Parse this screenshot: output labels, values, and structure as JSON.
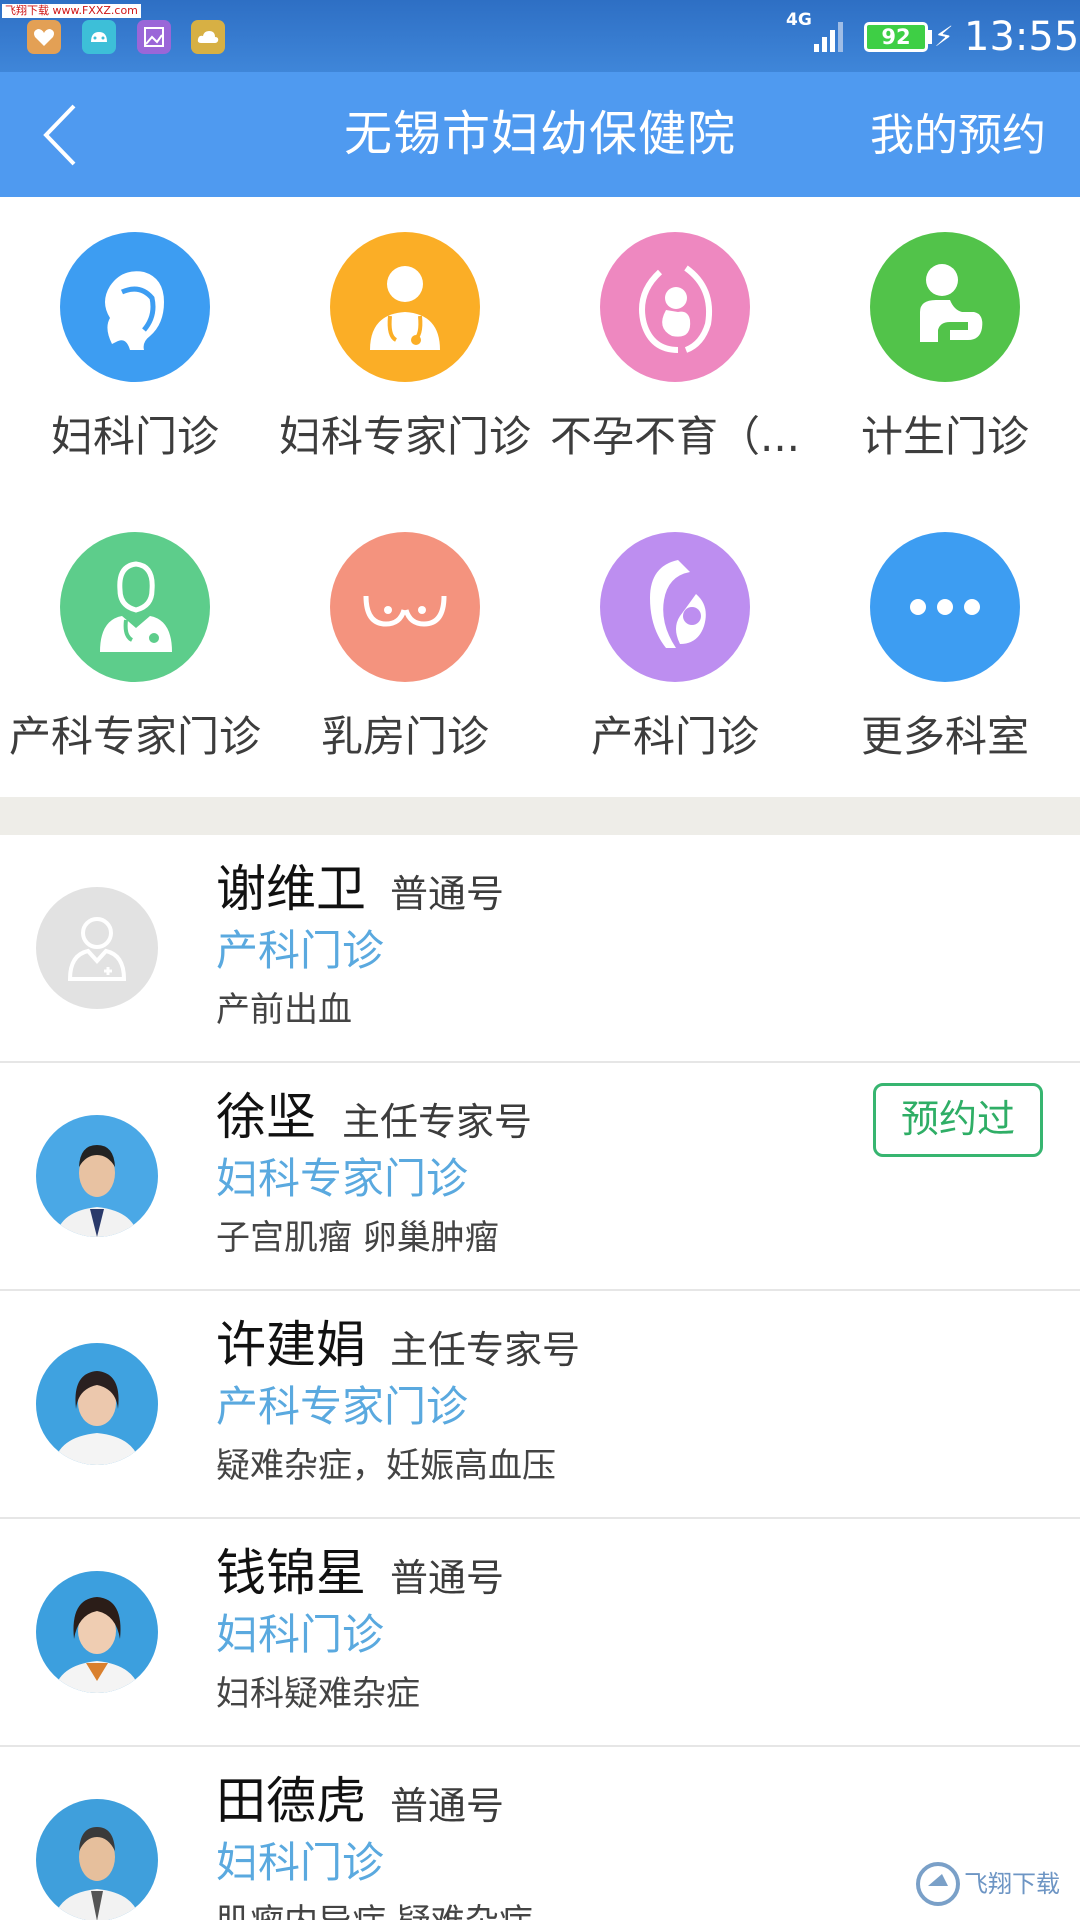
{
  "status_bar": {
    "watermark": "飞翔下载 www.FXXZ.com",
    "network": "4G",
    "battery": "92",
    "time": "13:55",
    "app_icons": [
      "heart-icon",
      "android-icon",
      "gallery-icon",
      "cloud-icon"
    ]
  },
  "header": {
    "title": "无锡市妇幼保健院",
    "my_appointments": "我的预约"
  },
  "departments": [
    {
      "label": "妇科门诊",
      "icon": "profile-head-icon",
      "color": "#3d9df2"
    },
    {
      "label": "妇科专家门诊",
      "icon": "doctor-icon",
      "color": "#fbae26"
    },
    {
      "label": "不孕不育（...",
      "icon": "pregnancy-icon",
      "color": "#ee88c0"
    },
    {
      "label": "计生门诊",
      "icon": "mother-child-icon",
      "color": "#52c34a"
    },
    {
      "label": "产科专家门诊",
      "icon": "female-doctor-icon",
      "color": "#5dcd8b"
    },
    {
      "label": "乳房门诊",
      "icon": "breast-icon",
      "color": "#f4937e"
    },
    {
      "label": "产科门诊",
      "icon": "mother-baby-icon",
      "color": "#bd8ef0"
    },
    {
      "label": "更多科室",
      "icon": "more-icon",
      "color": "#3d9df2"
    }
  ],
  "doctors": [
    {
      "name": "谢维卫",
      "type": "普通号",
      "department": "产科门诊",
      "specialty": "产前出血",
      "badge": ""
    },
    {
      "name": "徐坚",
      "type": "主任专家号",
      "department": "妇科专家门诊",
      "specialty": "子宫肌瘤 卵巢肿瘤",
      "badge": "预约过"
    },
    {
      "name": "许建娟",
      "type": "主任专家号",
      "department": "产科专家门诊",
      "specialty": "疑难杂症，妊娠高血压",
      "badge": ""
    },
    {
      "name": "钱锦星",
      "type": "普通号",
      "department": "妇科门诊",
      "specialty": "妇科疑难杂症",
      "badge": ""
    },
    {
      "name": "田德虎",
      "type": "普通号",
      "department": "妇科门诊",
      "specialty": "肌瘤内异症 疑难杂症",
      "badge": ""
    }
  ],
  "watermark_bottom": "飞翔下载"
}
